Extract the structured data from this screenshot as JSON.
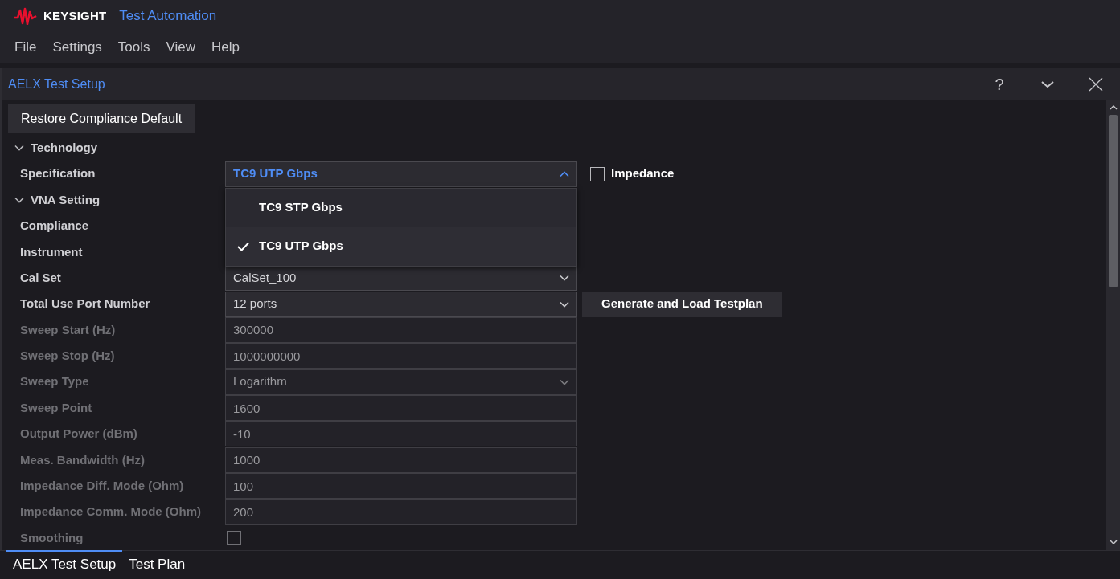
{
  "app": {
    "brand": "KEYSIGHT",
    "title": "Test Automation"
  },
  "menu": [
    "File",
    "Settings",
    "Tools",
    "View",
    "Help"
  ],
  "panel": {
    "title": "AELX Test Setup",
    "help": "?"
  },
  "restore_button": "Restore Compliance Default",
  "rows": [
    {
      "kind": "section",
      "label": "Technology",
      "expanded": true
    },
    {
      "kind": "dropdown",
      "label": "Specification",
      "value": "TC9 UTP Gbps",
      "disabled": false,
      "expanded": true,
      "options": [
        {
          "label": "TC9 STP Gbps",
          "selected": false
        },
        {
          "label": "TC9 UTP Gbps",
          "selected": true
        }
      ],
      "side_checkbox": {
        "label": "Impedance",
        "checked": false
      }
    },
    {
      "kind": "section",
      "label": "VNA Setting",
      "expanded": true
    },
    {
      "kind": "label",
      "label": "Compliance"
    },
    {
      "kind": "label",
      "label": "Instrument"
    },
    {
      "kind": "dropdown",
      "label": "Cal Set",
      "value": "CalSet_100",
      "disabled": false,
      "expanded": false
    },
    {
      "kind": "dropdown",
      "label": "Total Use Port Number",
      "value": "12 ports",
      "disabled": false,
      "expanded": false,
      "side_button": "Generate and Load Testplan"
    },
    {
      "kind": "text",
      "label": "Sweep Start (Hz)",
      "value": "300000",
      "disabled": true
    },
    {
      "kind": "text",
      "label": "Sweep Stop (Hz)",
      "value": "1000000000",
      "disabled": true
    },
    {
      "kind": "dropdown",
      "label": "Sweep Type",
      "value": "Logarithm",
      "disabled": true,
      "expanded": false
    },
    {
      "kind": "text",
      "label": "Sweep Point",
      "value": "1600",
      "disabled": true
    },
    {
      "kind": "text",
      "label": "Output Power (dBm)",
      "value": "-10",
      "disabled": true
    },
    {
      "kind": "text",
      "label": "Meas. Bandwidth (Hz)",
      "value": "1000",
      "disabled": true
    },
    {
      "kind": "text",
      "label": "Impedance Diff. Mode (Ohm)",
      "value": "100",
      "disabled": true
    },
    {
      "kind": "text",
      "label": "Impedance Comm. Mode (Ohm)",
      "value": "200",
      "disabled": true
    },
    {
      "kind": "checkbox",
      "label": "Smoothing",
      "checked": false,
      "disabled": true
    }
  ],
  "bottom_tabs": [
    {
      "label": "AELX Test Setup",
      "selected": true
    },
    {
      "label": "Test Plan",
      "selected": false
    }
  ]
}
